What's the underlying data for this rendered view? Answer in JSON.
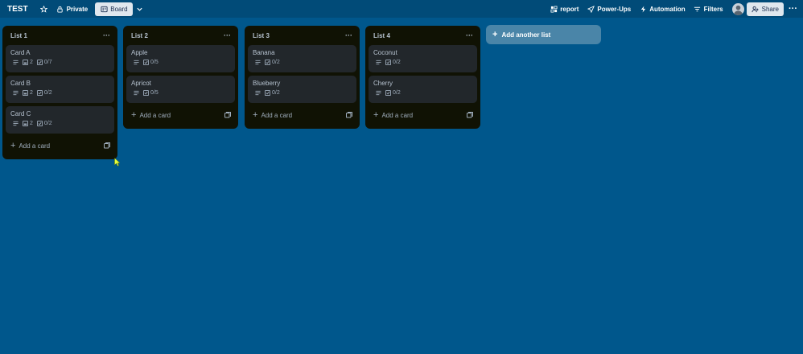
{
  "header": {
    "board_title": "TEST",
    "visibility_label": "Private",
    "view_label": "Board",
    "report_label": "report",
    "powerups_label": "Power-Ups",
    "automation_label": "Automation",
    "filters_label": "Filters",
    "share_label": "Share",
    "more": "···"
  },
  "lists": [
    {
      "title": "List 1",
      "menu": "···",
      "cards": [
        {
          "title": "Card A",
          "attachments": "2",
          "checklist": "0/7"
        },
        {
          "title": "Card B",
          "attachments": "2",
          "checklist": "0/2"
        },
        {
          "title": "Card C",
          "attachments": "2",
          "checklist": "0/2"
        }
      ],
      "add_card_label": "Add a card"
    },
    {
      "title": "List 2",
      "menu": "···",
      "cards": [
        {
          "title": "Apple",
          "checklist": "0/5"
        },
        {
          "title": "Apricot",
          "checklist": "0/5"
        }
      ],
      "add_card_label": "Add a card"
    },
    {
      "title": "List 3",
      "menu": "···",
      "cards": [
        {
          "title": "Banana",
          "checklist": "0/2"
        },
        {
          "title": "Blueberry",
          "checklist": "0/2"
        }
      ],
      "add_card_label": "Add a card"
    },
    {
      "title": "List 4",
      "menu": "···",
      "cards": [
        {
          "title": "Coconut",
          "checklist": "0/2"
        },
        {
          "title": "Cherry",
          "checklist": "0/2"
        }
      ],
      "add_card_label": "Add a card"
    }
  ],
  "add_list_label": "Add another list",
  "colors": {
    "board_bg": "#00578c",
    "header_bg": "#014b78",
    "list_bg": "#101204",
    "card_bg": "#22272b",
    "add_list_bg": "#4a85a8"
  }
}
